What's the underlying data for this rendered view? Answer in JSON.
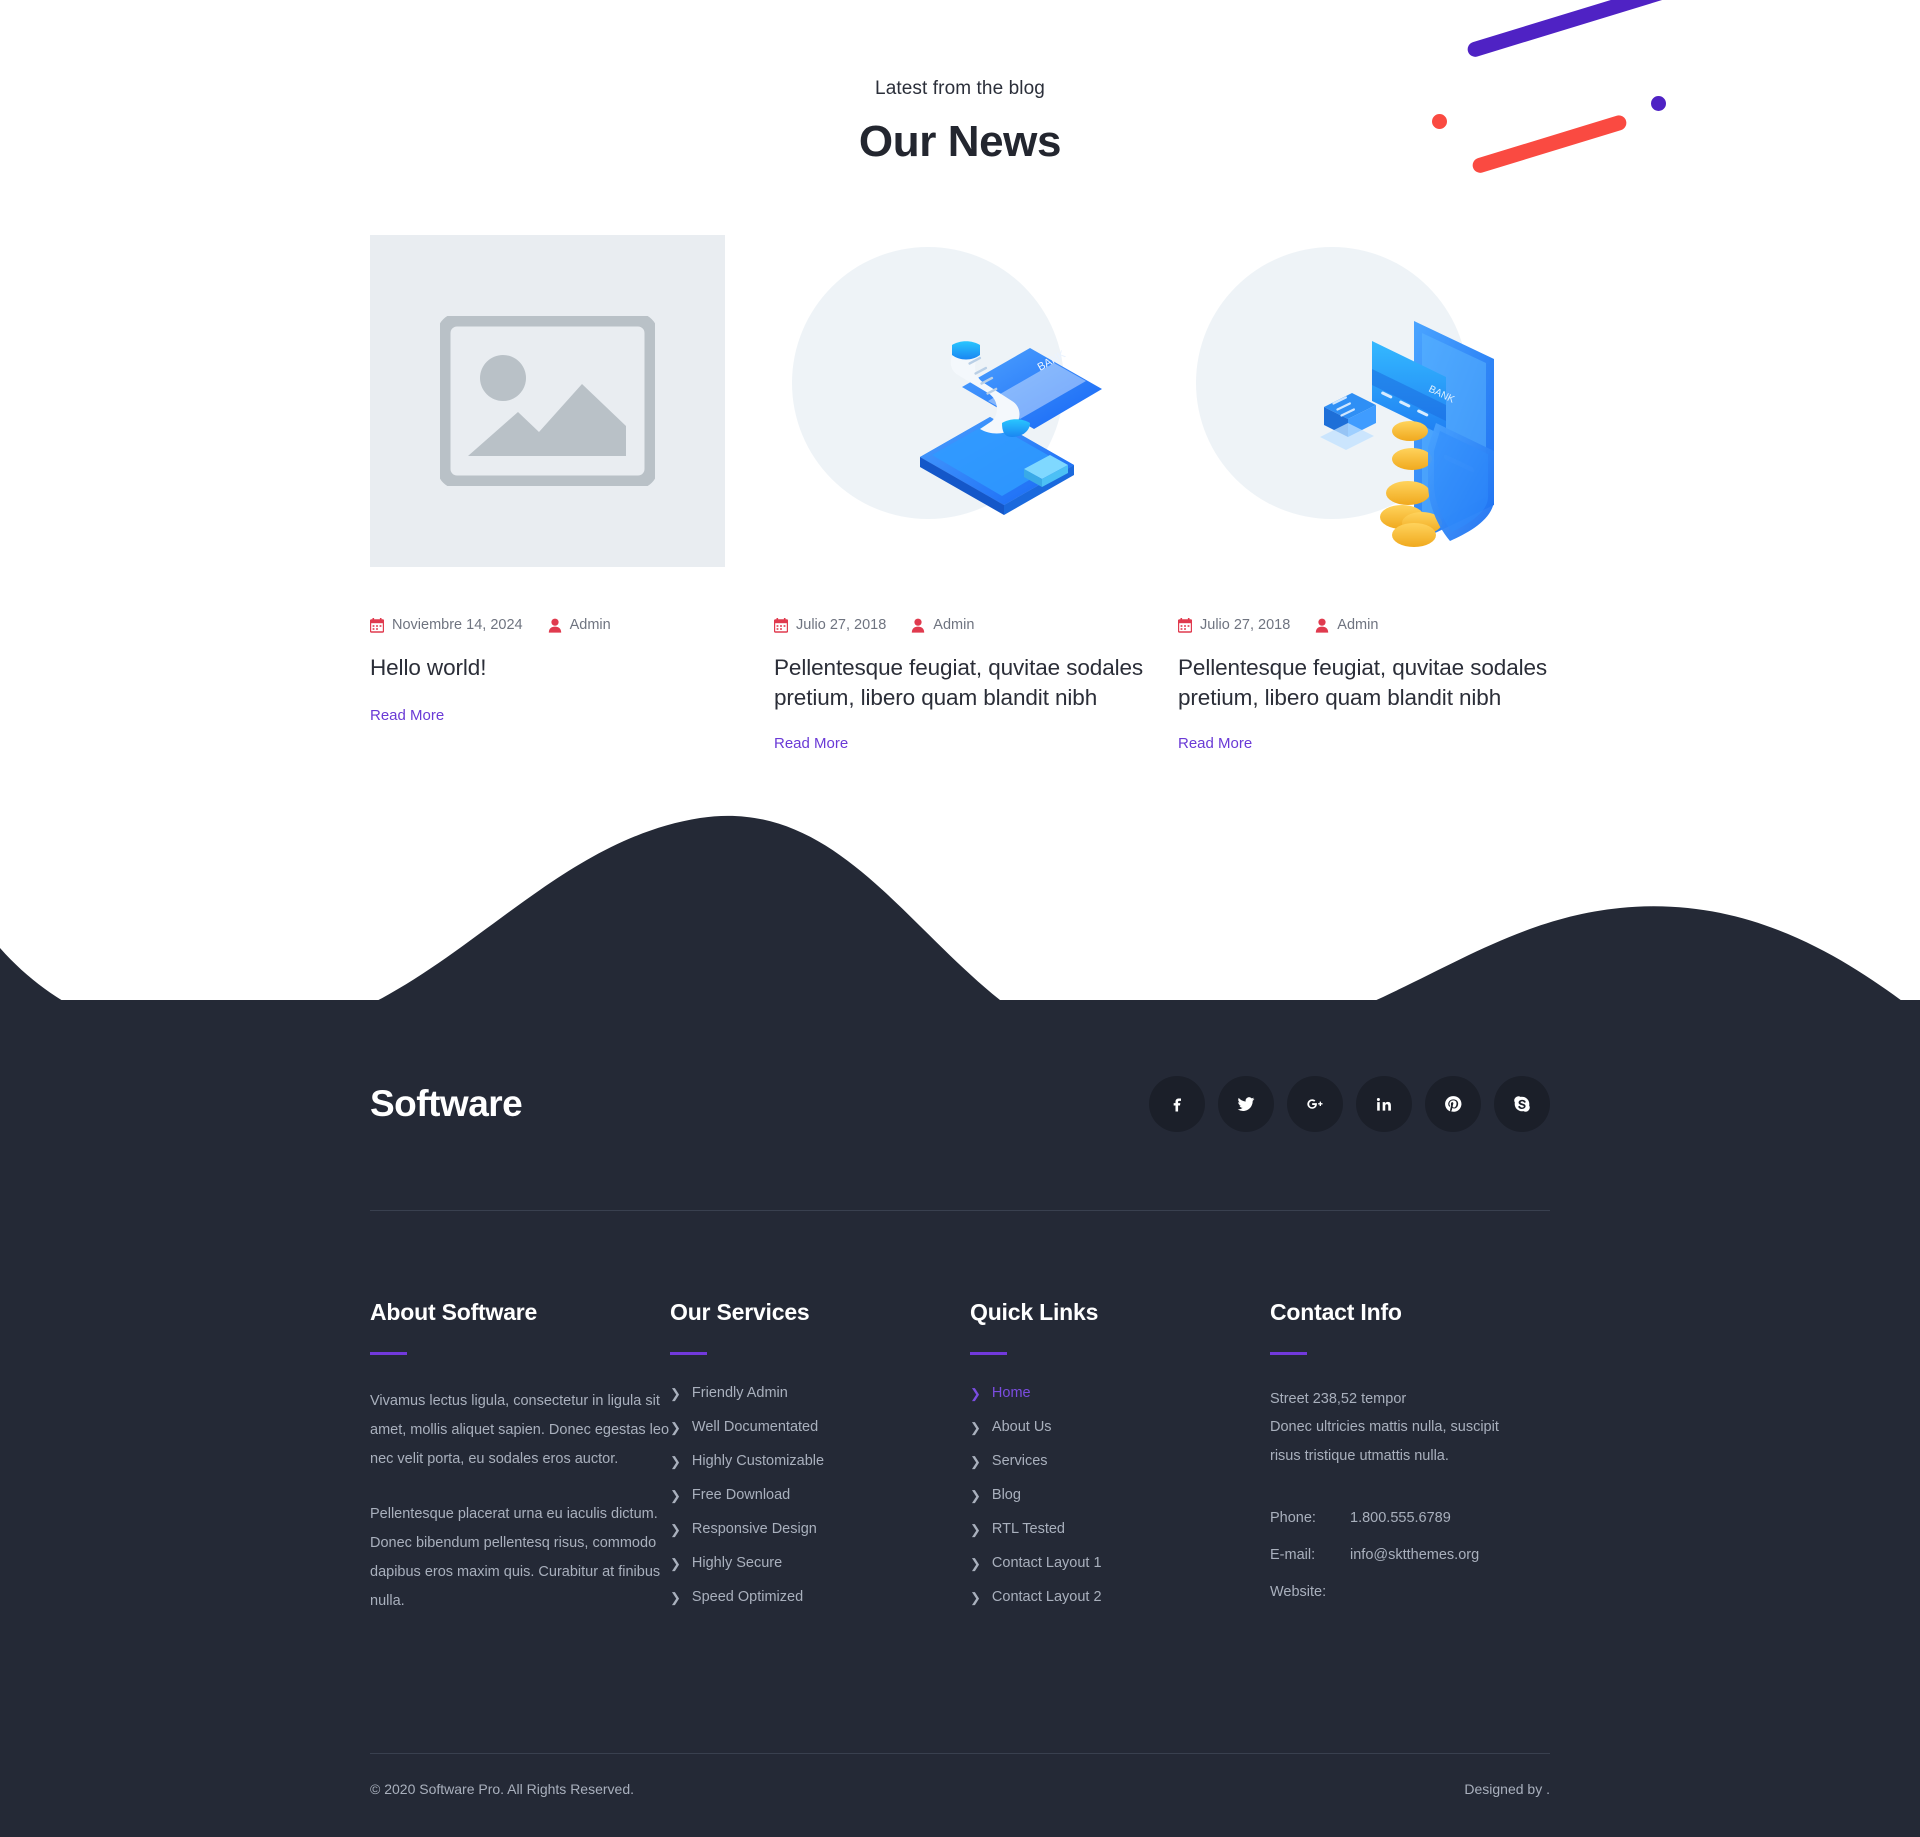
{
  "blog": {
    "subtitle": "Latest from the blog",
    "title": "Our News",
    "posts": [
      {
        "thumb_kind": "placeholder",
        "thumb_icon": "image-placeholder-icon",
        "date": "Noviembre 14, 2024",
        "author": "Admin",
        "title": "Hello world!",
        "read_more": "Read More"
      },
      {
        "thumb_kind": "illustration",
        "thumb_icon": "bank-receipt-phone-illustration",
        "date": "Julio 27, 2018",
        "author": "Admin",
        "title": "Pellentesque feugiat, quvitae sodales pretium, libero quam blandit nibh",
        "read_more": "Read More"
      },
      {
        "thumb_kind": "illustration",
        "thumb_icon": "secure-payment-shield-illustration",
        "date": "Julio 27, 2018",
        "author": "Admin",
        "title": "Pellentesque feugiat, quvitae sodales pretium, libero quam blandit nibh",
        "read_more": "Read More"
      }
    ]
  },
  "footer": {
    "brand": "Software",
    "socials": [
      {
        "name": "facebook-icon",
        "label": "f"
      },
      {
        "name": "twitter-icon",
        "label": "t"
      },
      {
        "name": "google-plus-icon",
        "label": "G+"
      },
      {
        "name": "linkedin-icon",
        "label": "in"
      },
      {
        "name": "pinterest-icon",
        "label": "p"
      },
      {
        "name": "skype-icon",
        "label": "S"
      }
    ],
    "about": {
      "heading": "About Software",
      "paragraph1": "Vivamus lectus ligula, consectetur in ligula sit amet, mollis aliquet sapien. Donec egestas leo nec velit porta, eu sodales eros auctor.",
      "paragraph2": "Pellentesque placerat urna eu iaculis dictum. Donec bibendum pellentesq risus, commodo dapibus eros maxim quis. Curabitur at finibus nulla."
    },
    "services": {
      "heading": "Our Services",
      "items": [
        "Friendly Admin",
        "Well Documentated",
        "Highly Customizable",
        "Free Download",
        "Responsive Design",
        "Highly Secure",
        "Speed Optimized"
      ]
    },
    "quick_links": {
      "heading": "Quick Links",
      "items": [
        "Home",
        "About Us",
        "Services",
        "Blog",
        "RTL Tested",
        "Contact Layout 1",
        "Contact Layout 2"
      ],
      "active_index": 0
    },
    "contact": {
      "heading": "Contact Info",
      "address_line1": "Street 238,52 tempor",
      "address_line2": "Donec ultricies mattis nulla, suscipit",
      "address_line3": "risus tristique utmattis nulla.",
      "phone_label": "Phone:",
      "phone_value": "1.800.555.6789",
      "email_label": "E-mail:",
      "email_value": "info@sktthemes.org",
      "website_label": "Website:",
      "website_value": ""
    },
    "copyright": "© 2020 Software Pro. All Rights Reserved.",
    "designed_by": "Designed by ."
  },
  "colors": {
    "accent_purple": "#6a3ad6",
    "rule_purple": "#7239dc",
    "meta_red": "#e03a4e",
    "footer_bg": "#242936",
    "deco_purple": "#4f22c4",
    "deco_red": "#fa4a41"
  }
}
